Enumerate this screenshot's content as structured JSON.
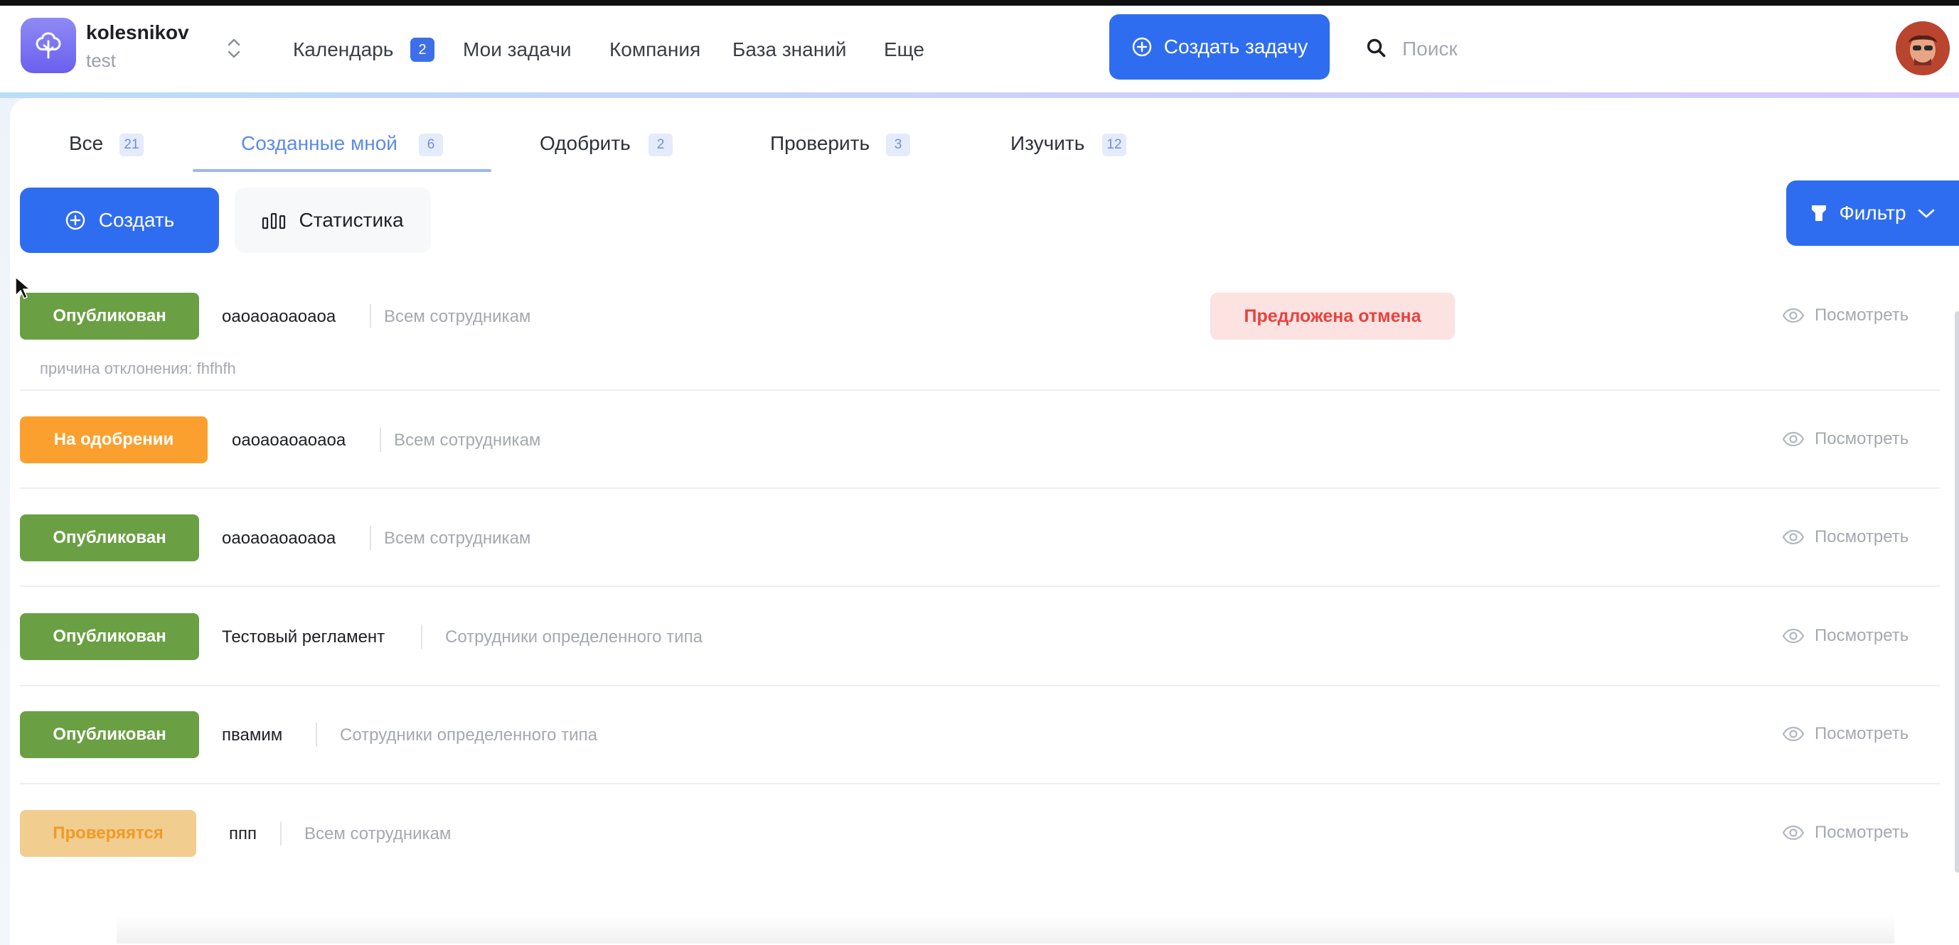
{
  "header": {
    "org_name": "kolesnikov",
    "org_sub": "test",
    "nav": [
      {
        "label": "Календарь",
        "badge": "2"
      },
      {
        "label": "Мои задачи"
      },
      {
        "label": "Компания"
      },
      {
        "label": "База знаний"
      },
      {
        "label": "Еще"
      }
    ],
    "create_task_label": "Создать задачу",
    "search_placeholder": "Поиск"
  },
  "tabs": [
    {
      "label": "Все",
      "count": "21"
    },
    {
      "label": "Созданные мной",
      "count": "6",
      "active": true
    },
    {
      "label": "Одобрить",
      "count": "2"
    },
    {
      "label": "Проверить",
      "count": "3"
    },
    {
      "label": "Изучить",
      "count": "12"
    }
  ],
  "toolbar": {
    "create_label": "Создать",
    "stats_label": "Статистика",
    "filter_label": "Фильтр"
  },
  "rows": [
    {
      "status": "Опубликован",
      "title": "оаоаоаоаоаоа",
      "audience": "Всем сотрудникам",
      "badge": "Предложена отмена",
      "reason": "причина отклонения: fhfhfh",
      "view": "Посмотреть"
    },
    {
      "status": "На одобрении",
      "title": "оаоаоаоаоаоа",
      "audience": "Всем сотрудникам",
      "view": "Посмотреть"
    },
    {
      "status": "Опубликован",
      "title": "оаоаоаоаоаоа",
      "audience": "Всем сотрудникам",
      "view": "Посмотреть"
    },
    {
      "status": "Опубликован",
      "title": "Тестовый регламент",
      "audience": "Сотрудники определенного типа",
      "view": "Посмотреть"
    },
    {
      "status": "Опубликован",
      "title": "пвамим",
      "audience": "Сотрудники определенного типа",
      "view": "Посмотреть"
    },
    {
      "status": "Проверяятся",
      "title": "ппп",
      "audience": "Всем сотрудникам",
      "view": "Посмотреть"
    }
  ],
  "colors": {
    "primary": "#2f6df0",
    "published": "#6aa043",
    "on_approval": "#fba02e",
    "checking_bg": "#f1cd8f",
    "checking_text": "#f09a27",
    "cancel_bg": "#fde2e2",
    "cancel_text": "#e8423c"
  }
}
